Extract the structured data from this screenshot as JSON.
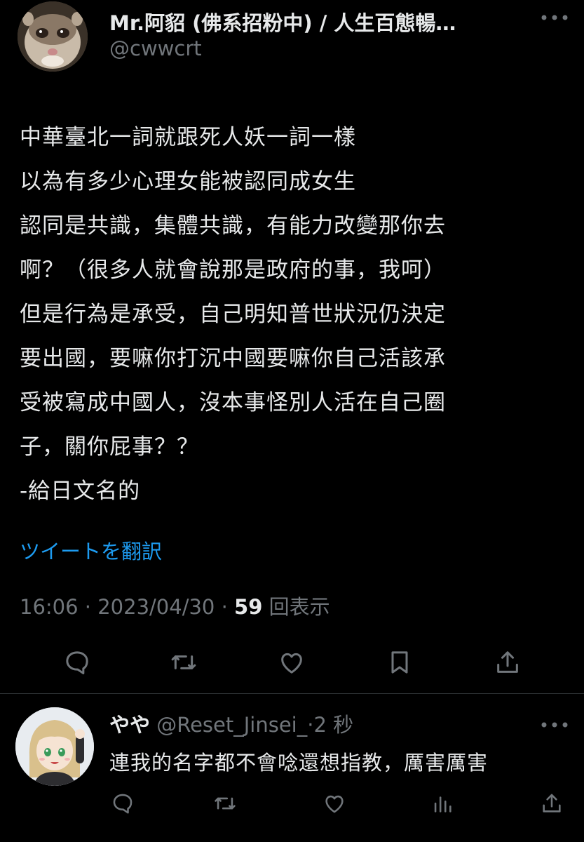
{
  "colors": {
    "background": "#000000",
    "text": "#e7e9ea",
    "secondary": "#71767b",
    "link": "#1d9bf0",
    "divider": "#2f3336"
  },
  "tweet": {
    "display_name": "Mr.阿貂 (佛系招粉中) / 人生百態暢…",
    "handle": "@cwwcrt",
    "text_lines": [
      "中華臺北一詞就跟死人妖一詞一樣",
      "以為有多少心理女能被認同成女生",
      "認同是共識，集體共識，有能力改變那你去",
      "啊？（很多人就會說那是政府的事，我呵）",
      "但是行為是承受，自己明知普世狀況仍決定",
      "要出國，要嘛你打沉中國要嘛你自己活該承",
      "受被寫成中國人，沒本事怪別人活在自己圈",
      "子，關你屁事？？",
      "-給日文名的"
    ],
    "translate_label": "ツイートを翻訳",
    "time": "16:06",
    "date": "2023/04/30",
    "separator": " · ",
    "views_count": "59",
    "views_label": "回表示",
    "actions": [
      {
        "name": "reply-icon",
        "icon": "speech-bubble"
      },
      {
        "name": "retweet-icon",
        "icon": "retweet-arrows"
      },
      {
        "name": "like-icon",
        "icon": "heart"
      },
      {
        "name": "bookmark-icon",
        "icon": "bookmark"
      },
      {
        "name": "share-icon",
        "icon": "upload-arrow"
      }
    ]
  },
  "reply": {
    "display_name": "やや",
    "handle": "@Reset_Jinsei_",
    "time": "·2 秒",
    "text": "連我的名字都不會唸還想指教，厲害厲害",
    "actions": [
      {
        "name": "reply-icon",
        "icon": "speech-bubble"
      },
      {
        "name": "retweet-icon",
        "icon": "retweet-arrows"
      },
      {
        "name": "like-icon",
        "icon": "heart"
      },
      {
        "name": "views-icon",
        "icon": "bar-chart"
      },
      {
        "name": "share-icon",
        "icon": "upload-arrow"
      }
    ]
  }
}
